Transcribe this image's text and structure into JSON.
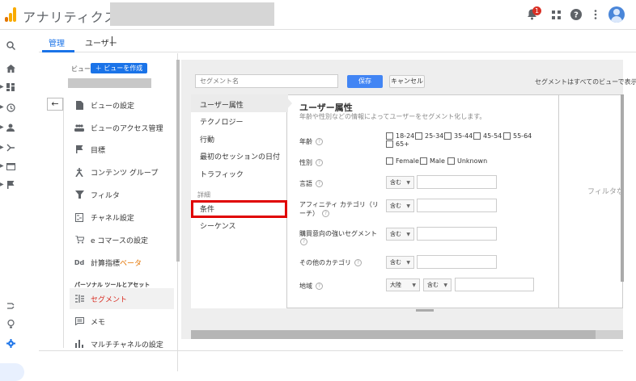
{
  "header": {
    "app_title": "アナリティクス",
    "notification_count": "1",
    "icons": [
      "bell-icon",
      "apps-grid-icon",
      "help-icon",
      "more-vert-icon",
      "account-avatar"
    ]
  },
  "tabs": [
    {
      "label": "管理",
      "active": true
    },
    {
      "label": "ユーザー",
      "active": false
    }
  ],
  "view": {
    "label": "ビュー",
    "create_button": "＋ ビューを作成"
  },
  "menu": {
    "items": [
      {
        "label": "ビューの設定",
        "icon": "document-icon"
      },
      {
        "label": "ビューのアクセス管理",
        "icon": "people-icon"
      },
      {
        "label": "目標",
        "icon": "flag-icon"
      },
      {
        "label": "コンテンツ グループ",
        "icon": "person-walk-icon"
      },
      {
        "label": "フィルタ",
        "icon": "filter-icon"
      },
      {
        "label": "チャネル設定",
        "icon": "channel-icon"
      },
      {
        "label": "e コマースの設定",
        "icon": "cart-icon"
      },
      {
        "label": "計算指標",
        "beta": "ベータ",
        "icon": "dd-icon"
      }
    ],
    "section_personal": "パーソナル ツールとアセット",
    "personal_items": [
      {
        "label": "セグメント",
        "icon": "segment-icon",
        "active": true
      },
      {
        "label": "メモ",
        "icon": "comment-icon"
      },
      {
        "label": "マルチチャネルの設定",
        "icon": "bar-chart-icon"
      }
    ]
  },
  "segment_editor": {
    "name_placeholder": "セグメント名",
    "save_label": "保存",
    "cancel_label": "キャンセル",
    "note": "セグメントはすべてのビューで表示",
    "nav": {
      "items": [
        "ユーザー属性",
        "テクノロジー",
        "行動",
        "最初のセッションの日付",
        "トラフィック"
      ],
      "advanced_label": "詳細",
      "advanced_items": [
        "条件",
        "シーケンス"
      ]
    },
    "content": {
      "title": "ユーザー属性",
      "description": "年齢や性別などの情報によってユーザーをセグメント化します。",
      "age_label": "年齢",
      "age_options": [
        "18-24",
        "25-34",
        "35-44",
        "45-54",
        "55-64",
        "65+"
      ],
      "gender_label": "性別",
      "gender_options": [
        "Female",
        "Male",
        "Unknown"
      ],
      "language_label": "言語",
      "affinity_label_1": "アフィニティ カテゴリ（リ",
      "affinity_label_2": "ーチ）",
      "in_market_label": "購買意向の強いセグメント",
      "other_label": "その他のカテゴリ",
      "region_label": "地域",
      "contains": "含む",
      "region_scope": "大陸",
      "help_glyph": "?"
    },
    "filter_hint": "フィルタな"
  }
}
